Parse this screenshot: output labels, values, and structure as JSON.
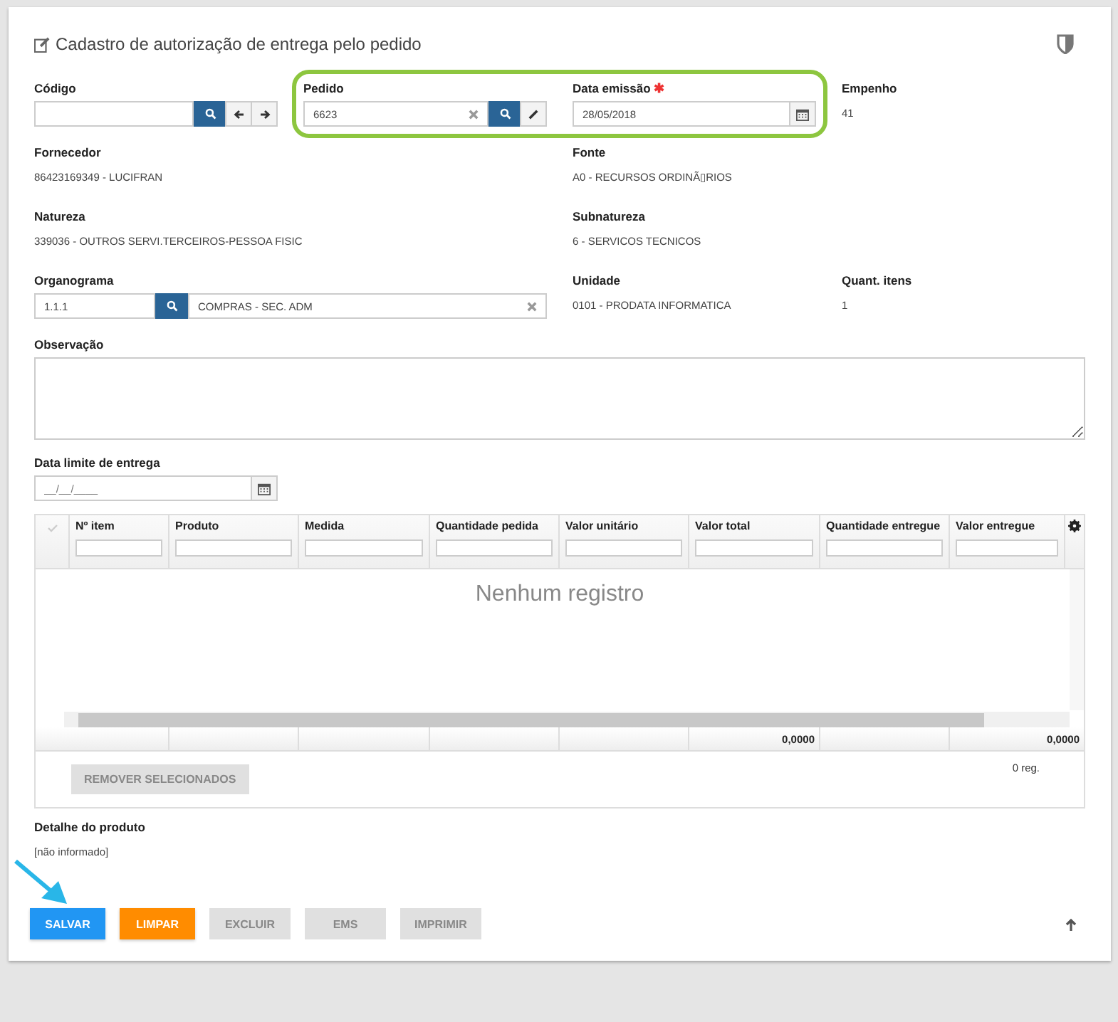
{
  "header": {
    "title": "Cadastro de autorização de entrega pelo pedido"
  },
  "codigo": {
    "label": "Código"
  },
  "pedido": {
    "label": "Pedido",
    "value": "6623",
    "highlighted": true
  },
  "data_emissao": {
    "label": "Data emissão",
    "required_mark": "✱",
    "value": "28/05/2018"
  },
  "empenho": {
    "label": "Empenho",
    "value": "41"
  },
  "info_rows": [
    {
      "left": {
        "label": "Fornecedor",
        "value": "86423169349 - LUCIFRAN"
      },
      "right": {
        "label": "Fonte",
        "value": "A0 - RECURSOS ORDINÃ▯RIOS"
      }
    },
    {
      "left": {
        "label": "Natureza",
        "value": "339036 - OUTROS SERVI.TERCEIROS-PESSOA FISIC"
      },
      "right": {
        "label": "Subnatureza",
        "value": "6 - SERVICOS TECNICOS"
      }
    }
  ],
  "organograma": {
    "label": "Organograma",
    "code": "1.1.1",
    "description": "COMPRAS - SEC. ADM"
  },
  "unidade": {
    "label": "Unidade",
    "value": "0101 - PRODATA INFORMATICA"
  },
  "quant_itens": {
    "label": "Quant. itens",
    "value": "1"
  },
  "observacao": {
    "label": "Observação"
  },
  "data_limite": {
    "label": "Data limite de entrega",
    "placeholder": "__/__/____"
  },
  "table": {
    "columns": [
      "Nº item",
      "Produto",
      "Medida",
      "Quantidade pedida",
      "Valor unitário",
      "Valor total",
      "Quantidade entregue",
      "Valor entregue"
    ],
    "empty_text": "Nenhum registro",
    "totals": {
      "valor_total": "0,0000",
      "valor_entregue": "0,0000"
    },
    "remove_button": {
      "label": "REMOVER SELECIONADOS",
      "disabled": true
    },
    "count": "0 reg."
  },
  "detalhe": {
    "label": "Detalhe do produto",
    "value": "[não informado]"
  },
  "buttons": [
    {
      "label": "SALVAR",
      "kind": "primary"
    },
    {
      "label": "LIMPAR",
      "kind": "warning"
    },
    {
      "label": "EXCLUIR",
      "kind": "default"
    },
    {
      "label": "EMS",
      "kind": "default"
    },
    {
      "label": "IMPRIMIR",
      "kind": "default"
    }
  ]
}
